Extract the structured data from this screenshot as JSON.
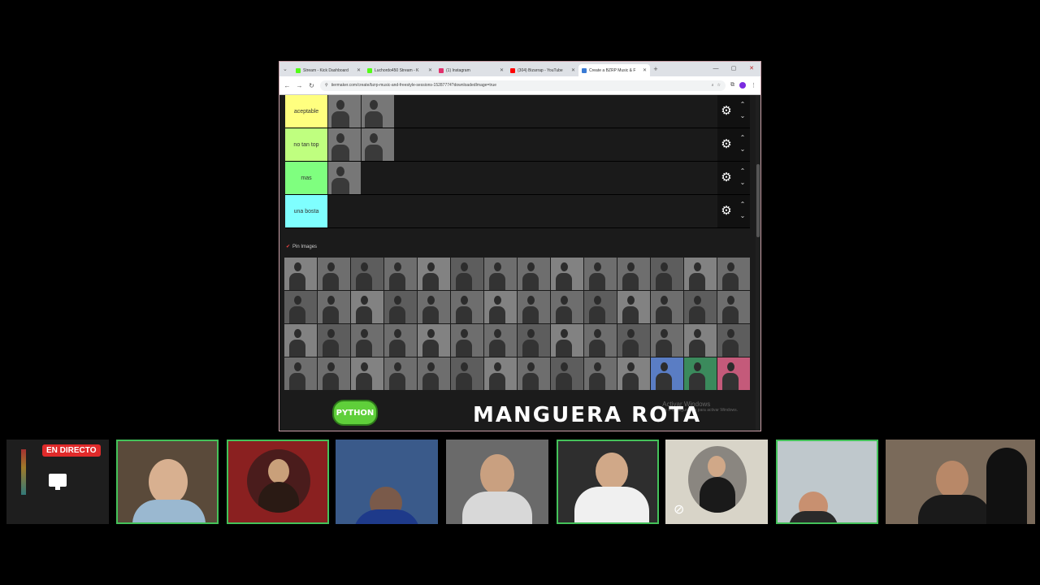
{
  "browser": {
    "tabs": [
      {
        "title": "Stream - Kick Dashboard",
        "color": "#53fc18",
        "active": false
      },
      {
        "title": "Luchordo450 Stream - K",
        "color": "#53fc18",
        "active": false
      },
      {
        "title": "(1) Instagram",
        "color": "#e1306c",
        "active": false
      },
      {
        "title": "(304) Bizarrap - YouTube",
        "color": "#ff0000",
        "active": false
      },
      {
        "title": "Create a BZRP Music & F",
        "color": "#3a7bd5",
        "active": true
      }
    ],
    "new_tab": "+",
    "url": "tiermaker.com/create/bzrp-music-and-freestyle-sessions-15287774?downloadedImage=true"
  },
  "tiers": [
    {
      "label": "aceptable",
      "color": "#ffff7f",
      "thumb_count": 2
    },
    {
      "label": "no tan top",
      "color": "#bfff7f",
      "thumb_count": 2
    },
    {
      "label": "mas",
      "color": "#7fff7f",
      "thumb_count": 1
    },
    {
      "label": "una bosta",
      "color": "#7fffff",
      "thumb_count": 0
    }
  ],
  "pool": {
    "title": "Pin Images",
    "thumb_count": 56
  },
  "watermark": {
    "line1": "Activar Windows",
    "line2": "Ve a Configuración para activar Windows."
  },
  "overlay": {
    "logo": "PYTHON",
    "title": "MANGUERA ROTA"
  },
  "participants": {
    "live_badge": "EN DIRECTO"
  }
}
